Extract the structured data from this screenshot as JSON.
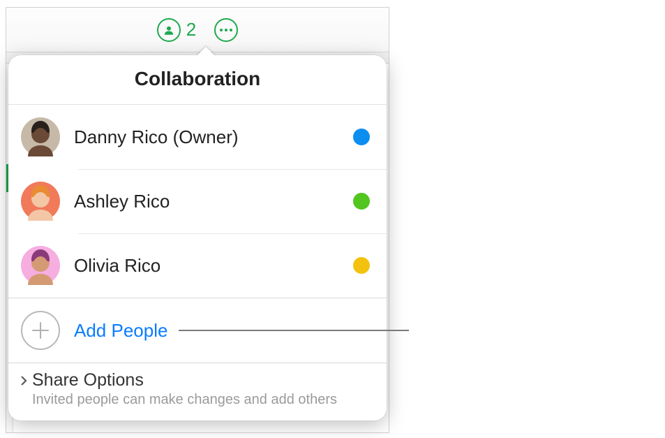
{
  "toolbar": {
    "people_count": "2"
  },
  "popover": {
    "title": "Collaboration",
    "participants": [
      {
        "name": "Danny Rico (Owner)",
        "dot_color": "#0b8ef0",
        "avatar_bg": "#c7b9a8",
        "avatar_hair": "#28201a",
        "avatar_face": "#6a4a36"
      },
      {
        "name": "Ashley Rico",
        "dot_color": "#52c51e",
        "avatar_bg": "#f07a5a",
        "avatar_hair": "#e98c34",
        "avatar_face": "#f3c7a6"
      },
      {
        "name": "Olivia Rico",
        "dot_color": "#f2c20f",
        "avatar_bg": "#f6aee0",
        "avatar_hair": "#8a3a7a",
        "avatar_face": "#d49a74"
      }
    ],
    "add_people_label": "Add People",
    "share_options": {
      "title": "Share Options",
      "subtitle": "Invited people can make changes and add others"
    }
  }
}
